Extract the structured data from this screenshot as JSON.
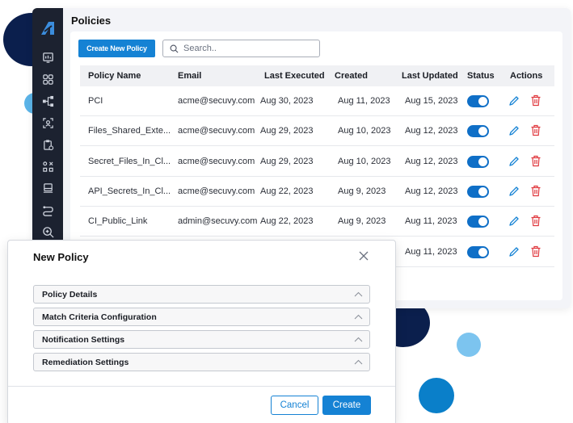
{
  "page": {
    "title": "Policies",
    "create_label": "Create New Policy",
    "search_placeholder": "Search.."
  },
  "table": {
    "columns": [
      "Policy Name",
      "Email",
      "Last Executed",
      "Created",
      "Last Updated",
      "Status",
      "Actions"
    ],
    "rows": [
      {
        "name": "PCI",
        "email": "acme@secuvy.com",
        "last_executed": "Aug 30, 2023",
        "created": "Aug 11, 2023",
        "last_updated": "Aug 15, 2023",
        "status": true
      },
      {
        "name": "Files_Shared_Exte...",
        "email": "acme@secuvy.com",
        "last_executed": "Aug 29, 2023",
        "created": "Aug 10, 2023",
        "last_updated": "Aug 12, 2023",
        "status": true
      },
      {
        "name": "Secret_Files_In_Cl...",
        "email": "acme@secuvy.com",
        "last_executed": "Aug 29, 2023",
        "created": "Aug 10, 2023",
        "last_updated": "Aug 12, 2023",
        "status": true
      },
      {
        "name": "API_Secrets_In_Cl...",
        "email": "acme@secuvy.com",
        "last_executed": "Aug 22, 2023",
        "created": "Aug 9, 2023",
        "last_updated": "Aug 12, 2023",
        "status": true
      },
      {
        "name": "CI_Public_Link",
        "email": "admin@secuvy.com",
        "last_executed": "Aug 22, 2023",
        "created": "Aug 9, 2023",
        "last_updated": "Aug 11, 2023",
        "status": true
      },
      {
        "name": "",
        "email": "",
        "last_executed": "",
        "created": "",
        "last_updated": "Aug 11, 2023",
        "status": true
      }
    ]
  },
  "modal": {
    "title": "New Policy",
    "sections": [
      "Policy Details",
      "Match Criteria Configuration",
      "Notification Settings",
      "Remediation Settings"
    ],
    "cancel_label": "Cancel",
    "create_label": "Create"
  },
  "colors": {
    "accent": "#1582d4",
    "sidebar": "#1c2230",
    "toggle_on": "#0f6fc7",
    "delete": "#e0383e",
    "navy_circle": "#0b1f4d",
    "light_circle": "#5bb4e8"
  },
  "icons": {
    "sidebar": [
      "dashboard-icon",
      "grid-icon",
      "network-icon",
      "scan-face-icon",
      "clipboard-icon",
      "data-map-icon",
      "inbox-icon",
      "flow-icon",
      "search-zoom-icon"
    ],
    "row_actions": [
      "edit-pencil-icon",
      "trash-icon"
    ]
  }
}
